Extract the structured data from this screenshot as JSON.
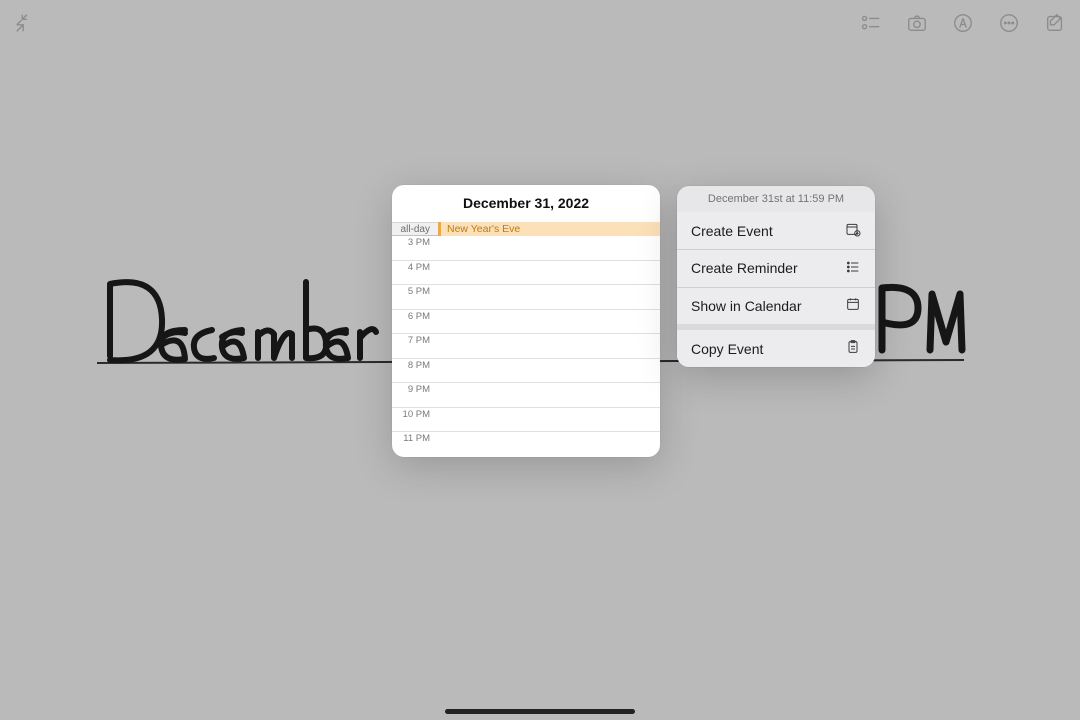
{
  "handwriting": {
    "left_word": "December",
    "right_fragment": "PM"
  },
  "calendar_popover": {
    "title": "December 31, 2022",
    "allday_label": "all-day",
    "allday_event": "New Year's Eve",
    "hours": [
      "3 PM",
      "4 PM",
      "5 PM",
      "6 PM",
      "7 PM",
      "8 PM",
      "9 PM",
      "10 PM",
      "11 PM"
    ]
  },
  "action_menu": {
    "header": "December 31st at 11:59 PM",
    "create_event": "Create Event",
    "create_reminder": "Create Reminder",
    "show_in_calendar": "Show in Calendar",
    "copy_event": "Copy Event"
  }
}
